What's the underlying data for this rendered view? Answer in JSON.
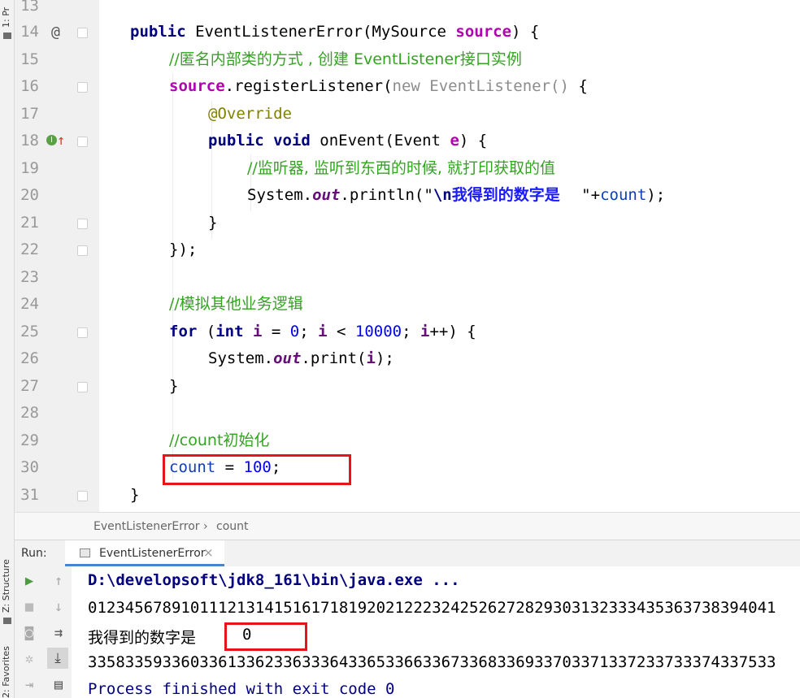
{
  "tool_strip": {
    "project_tab": "1: Pr",
    "structure_tab": "Z: Structure",
    "favorites_tab": "2: Favorites"
  },
  "editor": {
    "lines": [
      {
        "num": "13"
      },
      {
        "num": "14"
      },
      {
        "num": "15"
      },
      {
        "num": "16"
      },
      {
        "num": "17"
      },
      {
        "num": "18"
      },
      {
        "num": "19"
      },
      {
        "num": "20"
      },
      {
        "num": "21"
      },
      {
        "num": "22"
      },
      {
        "num": "23"
      },
      {
        "num": "24"
      },
      {
        "num": "25"
      },
      {
        "num": "26"
      },
      {
        "num": "27"
      },
      {
        "num": "28"
      },
      {
        "num": "29"
      },
      {
        "num": "30"
      },
      {
        "num": "31"
      }
    ],
    "tokens": {
      "l14_public": "public",
      "l14_name": "EventListenerError(",
      "l14_type": "MySource ",
      "l14_param": "source",
      "l14_end": ") {",
      "l15_comment": "//匿名内部类的方式 , 创建 EventListener接口实例",
      "l16_source": "source",
      "l16_call": ".registerListener(",
      "l16_new": "new EventListener()",
      "l16_end": " {",
      "l17_ann": "@Override",
      "l18_public": "public void",
      "l18_name": " onEvent(Event ",
      "l18_param": "e",
      "l18_end": ") {",
      "l19_comment": "//监听器, 监听到东西的时候, 就打印获取的值",
      "l20_sys": "System.",
      "l20_out": "out",
      "l20_println": ".println(",
      "l20_q1": "\"",
      "l20_esc": "\\n",
      "l20_text": "我得到的数字是    ",
      "l20_q2": "\"",
      "l20_plus": "+",
      "l20_count": "count",
      "l20_end": ");",
      "l21_close": "}",
      "l22_close": "});",
      "l24_comment": "//模拟其他业务逻辑",
      "l25_for": "for",
      "l25_open": " (",
      "l25_int": "int",
      "l25_i1": " i",
      "l25_eq": " = ",
      "l25_zero": "0",
      "l25_semi": "; ",
      "l25_i2": "i",
      "l25_lt": " < ",
      "l25_max": "10000",
      "l25_semi2": "; ",
      "l25_i3": "i",
      "l25_end": "++) {",
      "l26_sys": "System.",
      "l26_out": "out",
      "l26_print": ".print(",
      "l26_i": "i",
      "l26_end": ");",
      "l27_close": "}",
      "l29_comment": "//count初始化",
      "l30_count": "count",
      "l30_eq": " = ",
      "l30_val": "100",
      "l30_semi": ";",
      "l31_close": "}"
    }
  },
  "breadcrumb": {
    "class_name": "EventListenerError",
    "separator": "›",
    "member": "count"
  },
  "run_panel": {
    "label": "Run:",
    "tab_label": "EventListenerError",
    "close": "×"
  },
  "console": {
    "cmd": "D:\\developsoft\\jdk8_161\\bin\\java.exe ...",
    "output1": "01234567891011121314151617181920212223242526272829303132333435363738394041",
    "result_label": "我得到的数字是",
    "result_value": "0",
    "output2": "33583359336033613362336333643365336633673368336933703371337233733374337533",
    "finished": "Process finished with exit code 0"
  },
  "colors": {
    "keyword": "#000080",
    "comment": "#34a322",
    "number": "#0000ff",
    "highlight_box": "#e8141b",
    "field": "#0c3fb8"
  }
}
